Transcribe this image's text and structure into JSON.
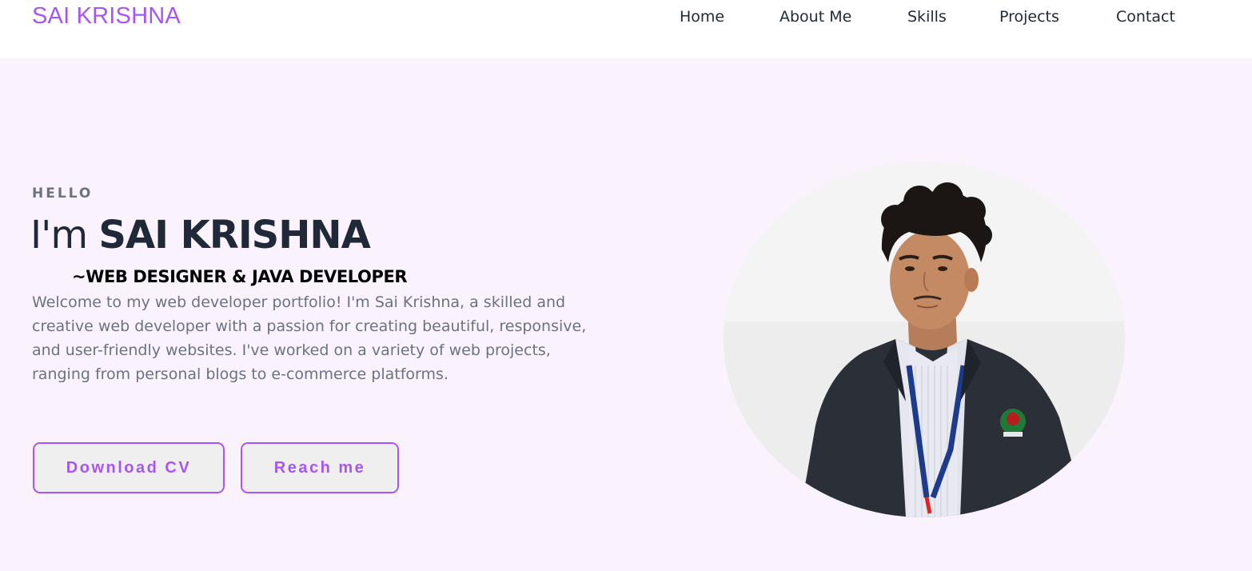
{
  "brand": {
    "name": "SAI KRISHNA",
    "accent_color": "#a855f7"
  },
  "nav": {
    "items": [
      {
        "label": "Home"
      },
      {
        "label": "About Me"
      },
      {
        "label": "Skills"
      },
      {
        "label": "Projects"
      },
      {
        "label": "Contact"
      }
    ]
  },
  "hero": {
    "greeting": "HELLO",
    "heading_prefix": "I'm ",
    "heading_name": "SAI KRISHNA",
    "role": "~WEB DESIGNER & JAVA DEVELOPER",
    "intro": "Welcome to my web developer portfolio! I'm Sai Krishna, a skilled and creative web developer with a passion for creating beautiful, responsive, and user-friendly websites. I've worked on a variety of web projects, ranging from personal blogs to e-commerce platforms.",
    "buttons": {
      "download_cv": "Download CV",
      "reach_me": "Reach me"
    },
    "portrait_icon": "profile-photo"
  },
  "colors": {
    "hero_background": "#faf3fe",
    "text_dark": "#1f2937",
    "text_muted": "#6b7280"
  }
}
